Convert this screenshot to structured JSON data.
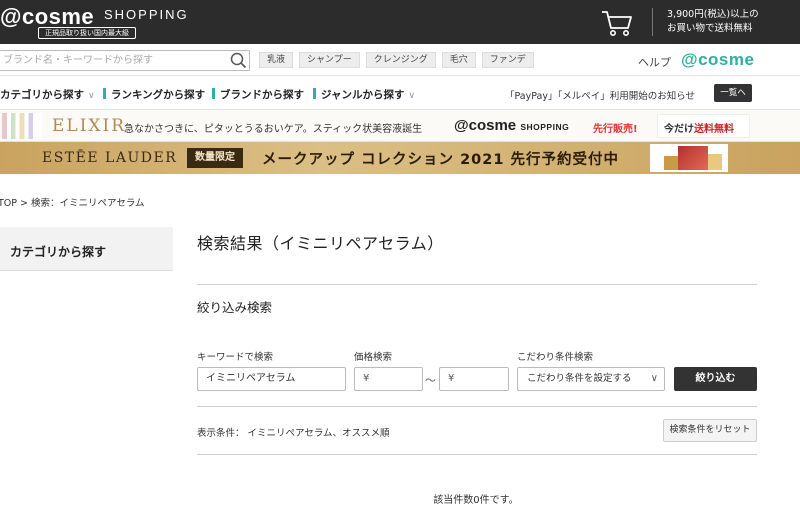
{
  "header": {
    "logo": "@cosme",
    "logo_sub": "SHOPPING",
    "badge": "正規品取り扱い国内最大級",
    "free_shipping_line1": "3,900円(税込)以上の",
    "free_shipping_line2": "お買い物で送料無料"
  },
  "search": {
    "placeholder": "ブランド名・キーワードから探す",
    "tags": [
      "乳液",
      "シャンプー",
      "クレンジング",
      "毛穴",
      "ファンデ"
    ],
    "help": "ヘルプ",
    "cosme_logo": "@cosme"
  },
  "nav": {
    "items": [
      "カテゴリから探す",
      "ランキングから探す",
      "ブランドから探す",
      "ジャンルから探す"
    ],
    "notice": "「PayPay」「メルペイ」利用開始のお知らせ",
    "list_button": "一覧へ"
  },
  "banner1": {
    "brand": "ELIXIR",
    "text": "急なかさつきに、ピタッとうるおいケア。スティック状美容液誕生",
    "cosme": "@cosme",
    "cosme_sub": "SHOPPING",
    "first": "先行販売!",
    "free_prefix": "今だけ",
    "free": "送料無料"
  },
  "banner2": {
    "brand": "ESTĒE LAUDER",
    "badge": "数量限定",
    "text": "メークアップ コレクション 2021 先行予約受付中"
  },
  "breadcrumb": "TOP > 検索：イミニリペアセラム",
  "sidebar": {
    "category": "カテゴリから探す"
  },
  "main": {
    "title": "検索結果（イミニリペアセラム）",
    "filter_title": "絞り込み検索",
    "keyword_label": "キーワードで検索",
    "keyword_value": "イミニリペアセラム",
    "price_label": "価格検索",
    "price_min": "¥",
    "price_max": "¥",
    "tilde": "〜",
    "condition_label": "こだわり条件検索",
    "condition_select": "こだわり条件を設定する",
    "submit": "絞り込む",
    "display_condition": "表示条件：  イミニリペアセラム、オススメ順",
    "reset": "検索条件をリセット",
    "no_result": "該当件数0件です。"
  }
}
